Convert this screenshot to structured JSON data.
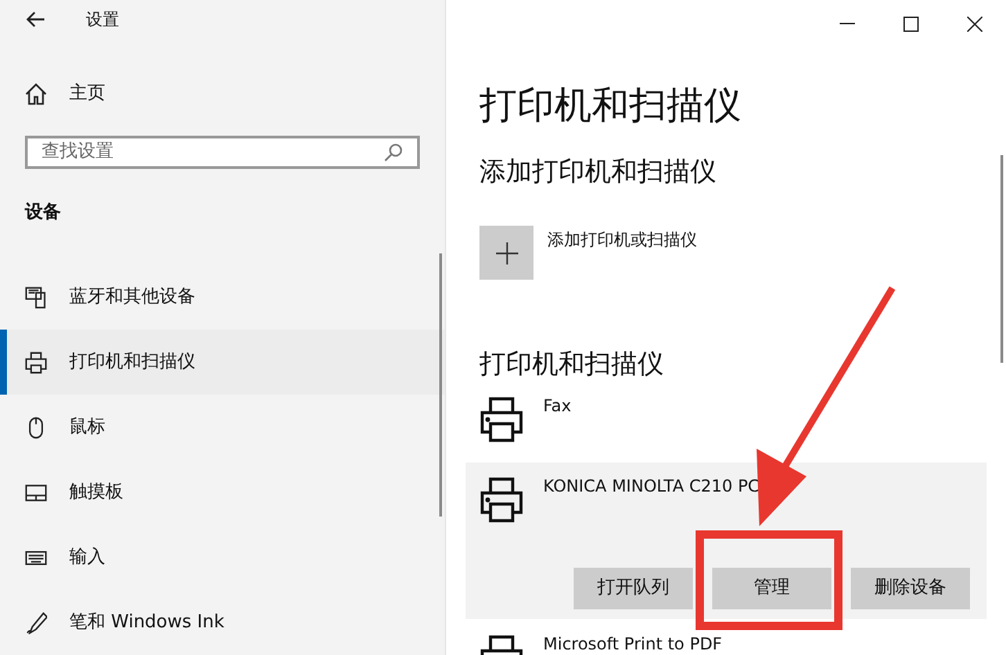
{
  "window": {
    "title": "设置"
  },
  "sidebar": {
    "home": "主页",
    "search": {
      "placeholder": "查找设置"
    },
    "section": "设备",
    "items": [
      {
        "label": "蓝牙和其他设备",
        "selected": false
      },
      {
        "label": "打印机和扫描仪",
        "selected": true
      },
      {
        "label": "鼠标",
        "selected": false
      },
      {
        "label": "触摸板",
        "selected": false
      },
      {
        "label": "输入",
        "selected": false
      },
      {
        "label": "笔和 Windows Ink",
        "selected": false
      }
    ]
  },
  "main": {
    "title": "打印机和扫描仪",
    "add_section": {
      "heading": "添加打印机和扫描仪",
      "button": "添加打印机或扫描仪"
    },
    "printers_section": {
      "heading": "打印机和扫描仪",
      "printers": [
        {
          "name": "Fax",
          "selected": false
        },
        {
          "name": "KONICA MINOLTA C210 PC",
          "selected": true,
          "actions": [
            {
              "label": "打开队列",
              "highlighted": false
            },
            {
              "label": "管理",
              "highlighted": true
            },
            {
              "label": "删除设备",
              "highlighted": false
            }
          ]
        },
        {
          "name": "Microsoft Print to PDF",
          "selected": false
        }
      ]
    }
  }
}
